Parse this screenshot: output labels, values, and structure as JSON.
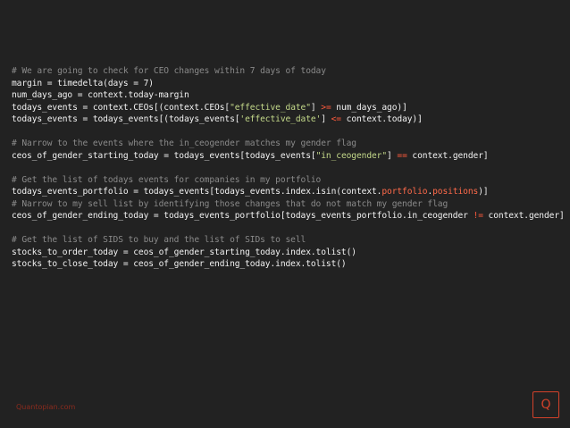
{
  "code": {
    "l1": "# We are going to check for CEO changes within 7 days of today",
    "l2": "margin = timedelta(days = 7)",
    "l3": "num_days_ago = context.today-margin",
    "l4a": "todays_events = context.CEOs[(context.CEOs[",
    "l4b": "\"effective_date\"",
    "l4c": "] ",
    "l4d": ">=",
    "l4e": " num_days_ago)]",
    "l5a": "todays_events = todays_events[(todays_events[",
    "l5b": "'effective_date'",
    "l5c": "] ",
    "l5d": "<=",
    "l5e": " context.today)]",
    "l6": "# Narrow to the events where the in_ceogender matches my gender flag",
    "l7a": "ceos_of_gender_starting_today = todays_events[todays_events[",
    "l7b": "\"in_ceogender\"",
    "l7c": "] ",
    "l7d": "==",
    "l7e": " context.gender]",
    "l8": "# Get the list of todays events for companies in my portfolio",
    "l9a": "todays_events_portfolio = todays_events[todays_events.index.isin(context.",
    "l9b": "portfolio",
    "l9c": ".",
    "l9d": "positions",
    "l9e": ")]",
    "l10": "# Narrow to my sell list by identifying those changes that do not match my gender flag",
    "l11a": "ceos_of_gender_ending_today = todays_events_portfolio[todays_events_portfolio.in_ceogender ",
    "l11b": "!=",
    "l11c": " context.gender]",
    "l12": "# Get the list of SIDS to buy and the list of SIDs to sell",
    "l13": "stocks_to_order_today = ceos_of_gender_starting_today.index.tolist()",
    "l14": "stocks_to_close_today = ceos_of_gender_ending_today.index.tolist()"
  },
  "footer": {
    "brand": "Quantopian.com",
    "logo_letter": "Q"
  },
  "colors": {
    "background": "#222222",
    "code_text": "#f2f2f2",
    "comment": "#8a8a8a",
    "string": "#c4d98a",
    "operator": "#ff5a3c",
    "accent": "#d3412a"
  }
}
